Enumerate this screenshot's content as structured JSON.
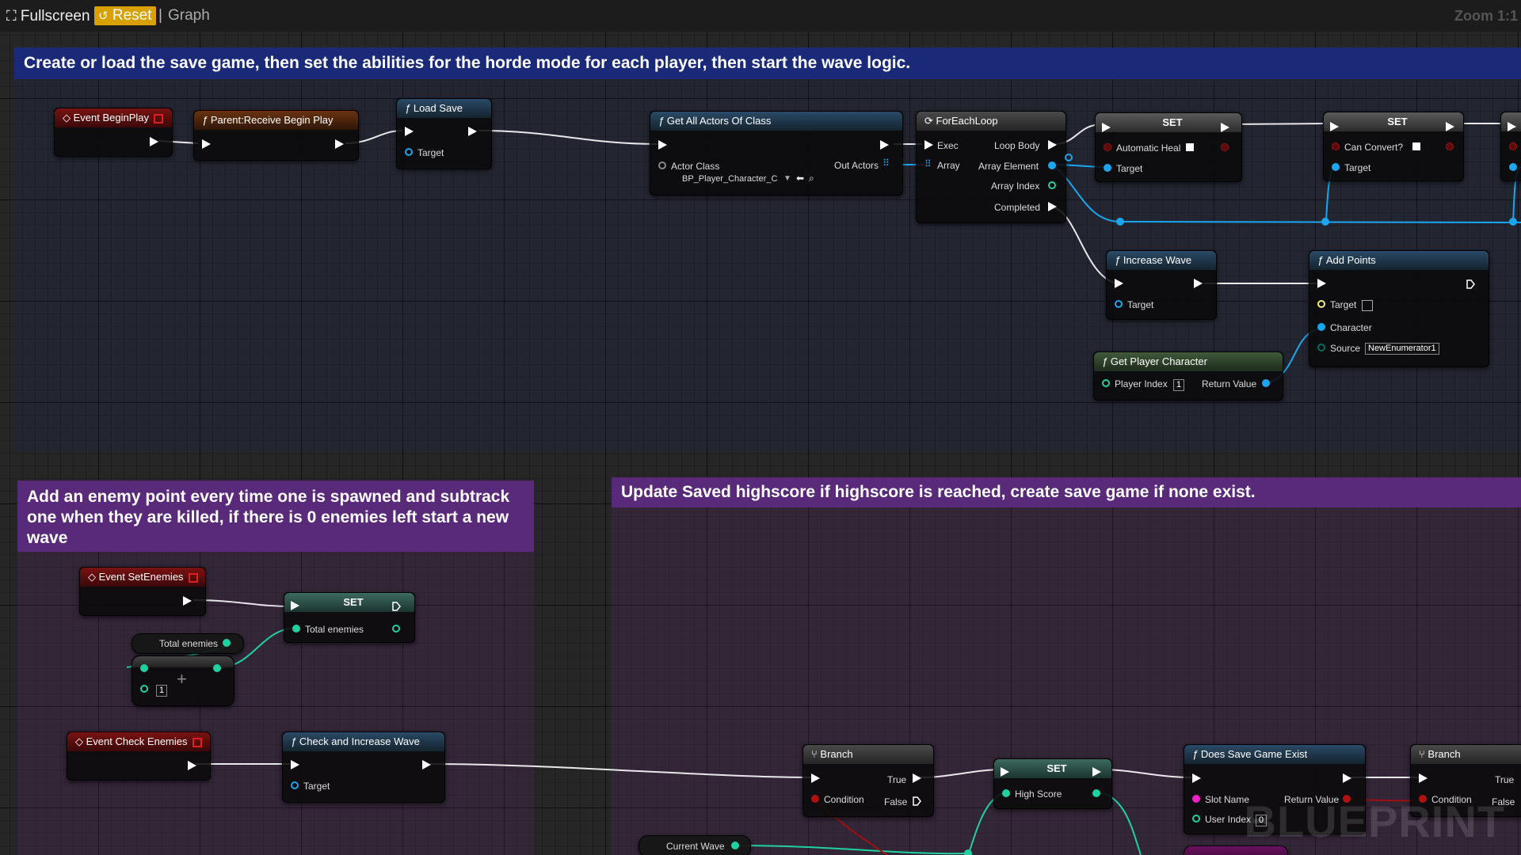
{
  "toolbar": {
    "fullscreen_label": "Fullscreen",
    "reset_label": "Reset",
    "separator": "|",
    "graph_label": "Graph",
    "zoom_label": "Zoom 1:1"
  },
  "comments": [
    {
      "text": "Create or load the save game, then set the abilities for the horde mode for each player, then start the wave logic.",
      "color": "#1a2a78"
    },
    {
      "text": "Add an enemy point every time one is spawned and subtrack one when they are killed, if there is 0 enemies left start a new wave",
      "color": "#5a2a7a"
    },
    {
      "text": "Update Saved highscore if highscore is reached, create save game if none exist.",
      "color": "#5a2a7a"
    }
  ],
  "nodes": {
    "event_begin_play": {
      "title": "Event BeginPlay"
    },
    "parent_begin_play": {
      "title": "Parent:Receive Begin Play"
    },
    "load_save": {
      "title": "Load Save",
      "target": "Target"
    },
    "get_all_actors": {
      "title": "Get All Actors Of Class",
      "actor_class": "Actor Class",
      "class_value": "BP_Player_Character_C",
      "out_actors": "Out Actors"
    },
    "foreach": {
      "title": "ForEachLoop",
      "exec": "Exec",
      "array": "Array",
      "loop_body": "Loop Body",
      "array_element": "Array Element",
      "array_index": "Array Index",
      "completed": "Completed"
    },
    "set_heal": {
      "title": "SET",
      "var": "Automatic Heal",
      "target": "Target"
    },
    "set_convert": {
      "title": "SET",
      "var": "Can Convert?",
      "target": "Target"
    },
    "increase_wave": {
      "title": "Increase Wave",
      "target": "Target"
    },
    "add_points": {
      "title": "Add Points",
      "target": "Target",
      "character": "Character",
      "source": "Source",
      "source_value": "NewEnumerator1"
    },
    "get_player_character": {
      "title": "Get Player Character",
      "player_index": "Player Index",
      "player_index_value": "1",
      "return_value": "Return Value"
    },
    "event_set_enemies": {
      "title": "Event SetEnemies"
    },
    "set_total": {
      "title": "SET",
      "var": "Total enemies"
    },
    "total_enemies_get": {
      "label": "Total enemies"
    },
    "add_node": {
      "plus": "+",
      "value": "1"
    },
    "event_check_enemies": {
      "title": "Event Check Enemies"
    },
    "check_increase_wave": {
      "title": "Check and Increase Wave",
      "target": "Target"
    },
    "branch1": {
      "title": "Branch",
      "condition": "Condition",
      "true_label": "True",
      "false_label": "False"
    },
    "set_high_score": {
      "title": "SET",
      "var": "High Score"
    },
    "does_save_exist": {
      "title": "Does Save Game Exist",
      "slot_name": "Slot Name",
      "user_index": "User Index",
      "user_index_value": "0",
      "return_value": "Return Value"
    },
    "branch2": {
      "title": "Branch",
      "condition": "Condition",
      "true_label": "True",
      "false_label": "False"
    },
    "current_wave_get": {
      "label": "Current Wave"
    }
  },
  "watermark": "BLUEPRINT",
  "colors": {
    "exec": "#ffffff",
    "object_pin": "#1aa6f0",
    "int_pin": "#1fd1a0",
    "bool_pin": "#b01010",
    "string_pin": "#f020c8",
    "enum_pin": "#0a6b5a",
    "comment_blue": "#1a2a78",
    "comment_purple": "#5a2a7a"
  }
}
